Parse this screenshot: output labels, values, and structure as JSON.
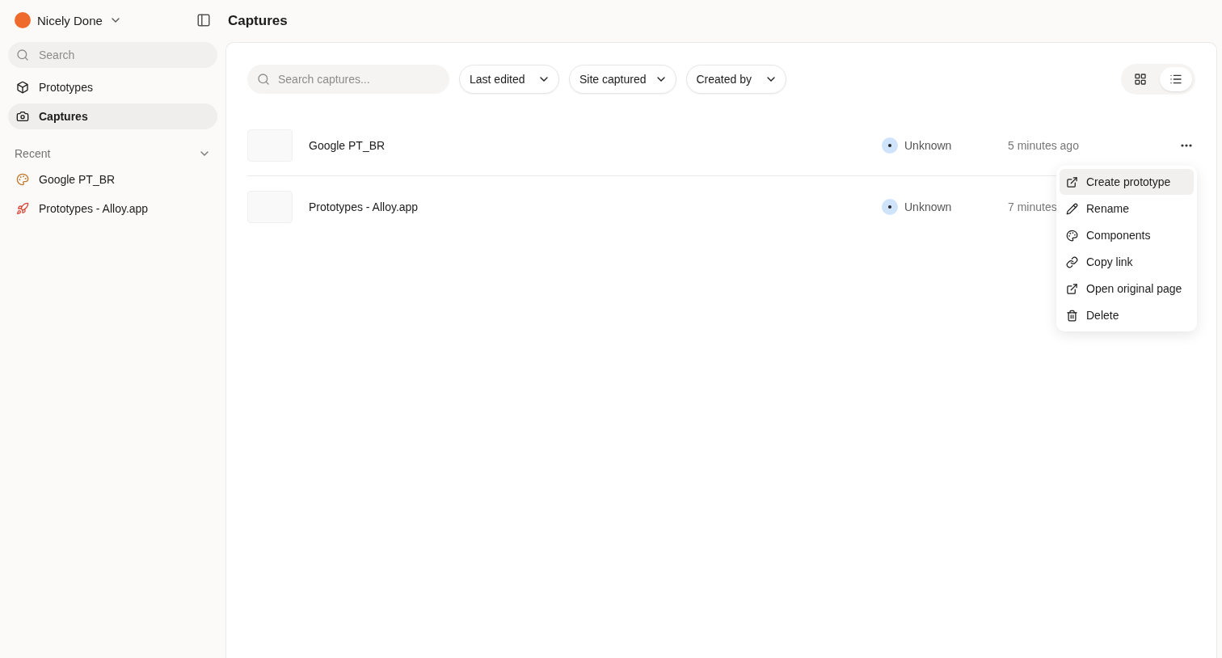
{
  "workspace": {
    "name": "Nicely Done"
  },
  "sidebar": {
    "search": {
      "placeholder": "Search"
    },
    "items": [
      {
        "label": "Prototypes",
        "kind": "box",
        "selected": false
      },
      {
        "label": "Captures",
        "kind": "camera",
        "selected": true
      }
    ],
    "recent": {
      "title": "Recent",
      "items": [
        {
          "label": "Google PT_BR",
          "kind": "palette"
        },
        {
          "label": "Prototypes - Alloy.app",
          "kind": "rocket"
        }
      ]
    }
  },
  "page": {
    "title": "Captures"
  },
  "toolbar": {
    "search": {
      "placeholder": "Search captures..."
    },
    "filters": [
      "Last edited",
      "Site captured",
      "Created by"
    ],
    "views": [
      {
        "kind": "grid",
        "selected": false
      },
      {
        "kind": "list",
        "selected": true
      }
    ]
  },
  "captures": [
    {
      "name": "Google PT_BR",
      "creator": "Unknown",
      "time": "5 minutes ago"
    },
    {
      "name": "Prototypes - Alloy.app",
      "creator": "Unknown",
      "time": "7 minutes"
    }
  ],
  "menu": [
    {
      "label": "Create prototype",
      "kind": "external",
      "selected": true
    },
    {
      "label": "Rename",
      "kind": "pencil",
      "selected": false
    },
    {
      "label": "Components",
      "kind": "palette",
      "selected": false
    },
    {
      "label": "Copy link",
      "kind": "link",
      "selected": false
    },
    {
      "label": "Open original page",
      "kind": "external",
      "selected": false
    },
    {
      "label": "Delete",
      "kind": "trash",
      "selected": false
    }
  ]
}
